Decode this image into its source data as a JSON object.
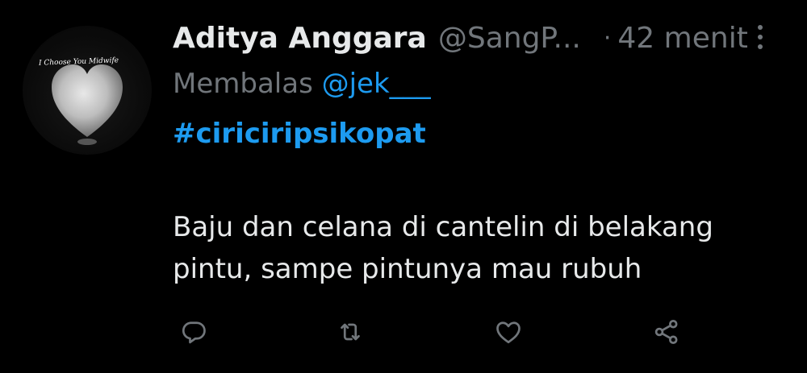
{
  "tweet": {
    "author_name": "Aditya Anggara",
    "author_handle": "@SangP...",
    "separator": "·",
    "time": "42 menit",
    "reply_prefix": "Membalas",
    "reply_to": "@jek___",
    "hashtag": "#ciriciripsikopat",
    "text": "Baju dan celana di cantelin di belakang pintu, sampe pintunya mau rubuh"
  },
  "avatar": {
    "caption": "I Choose You Midwife"
  },
  "actions": {
    "icons": [
      "reply-icon",
      "retweet-icon",
      "like-icon",
      "share-icon"
    ]
  },
  "colors": {
    "background": "#000000",
    "text": "#e7e9ea",
    "muted": "#71767b",
    "accent": "#1d9bf0"
  }
}
